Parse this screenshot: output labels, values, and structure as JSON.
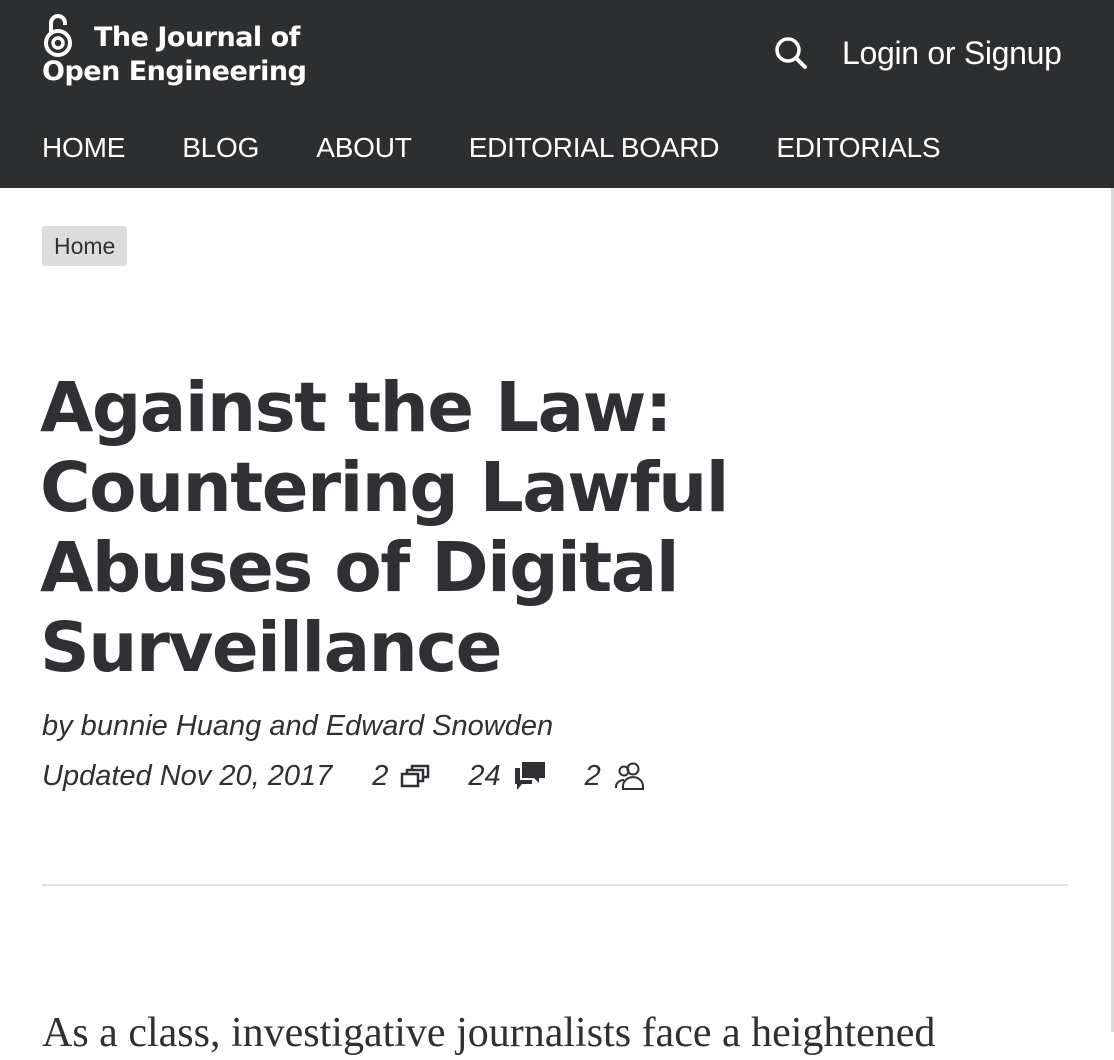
{
  "site": {
    "name_line1": "The Journal of",
    "name_line2": "Open Engineering"
  },
  "header": {
    "login_label": "Login or Signup"
  },
  "nav": {
    "items": [
      {
        "label": "HOME"
      },
      {
        "label": "BLOG"
      },
      {
        "label": "ABOUT"
      },
      {
        "label": "EDITORIAL BOARD"
      },
      {
        "label": "EDITORIALS"
      }
    ]
  },
  "breadcrumb": {
    "label": "Home"
  },
  "article": {
    "title": "Against the Law: Countering Lawful Abuses of Digital Surveillance",
    "byline": "by bunnie Huang and Edward Snowden",
    "updated": "Updated Nov 20, 2017",
    "stats": {
      "versions": "2",
      "comments": "24",
      "contributors": "2"
    },
    "body_start": "As a class, investigative journalists face a  heightened"
  },
  "icons": {
    "logo": "open-lock-icon",
    "search": "search-icon",
    "versions": "versions-icon",
    "comments": "comments-icon",
    "contributors": "people-icon"
  },
  "colors": {
    "header_bg": "#2d2e30",
    "text": "#2f3033",
    "breadcrumb_bg": "#dcdcdc"
  }
}
